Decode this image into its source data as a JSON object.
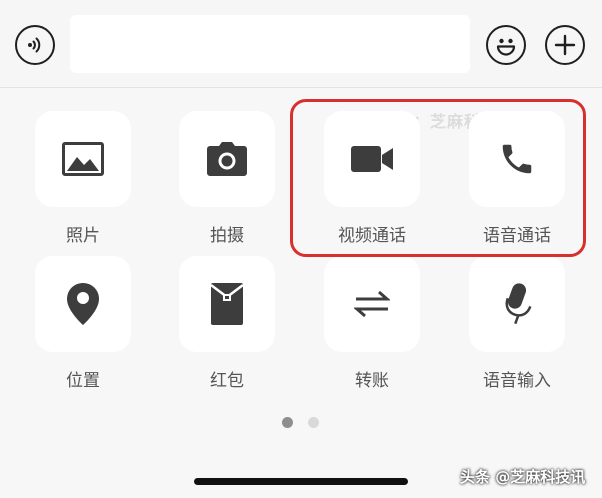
{
  "input_bar": {
    "voice_icon": "voice-wave-icon",
    "emoji_icon": "smiley-icon",
    "plus_icon": "plus-icon",
    "text_value": ""
  },
  "panel": {
    "row1": [
      {
        "label": "照片",
        "icon": "image-icon"
      },
      {
        "label": "拍摄",
        "icon": "camera-icon"
      },
      {
        "label": "视频通话",
        "icon": "video-camera-icon"
      },
      {
        "label": "语音通话",
        "icon": "phone-icon"
      }
    ],
    "row2": [
      {
        "label": "位置",
        "icon": "location-pin-icon"
      },
      {
        "label": "红包",
        "icon": "red-packet-icon"
      },
      {
        "label": "转账",
        "icon": "transfer-arrows-icon"
      },
      {
        "label": "语音输入",
        "icon": "microphone-icon"
      }
    ]
  },
  "pagination": {
    "current": 1,
    "total": 2
  },
  "highlight_color": "#d8302f",
  "watermarks": {
    "top": "公众号：芝麻科技讯",
    "bottom": "头条 @芝麻科技讯"
  }
}
